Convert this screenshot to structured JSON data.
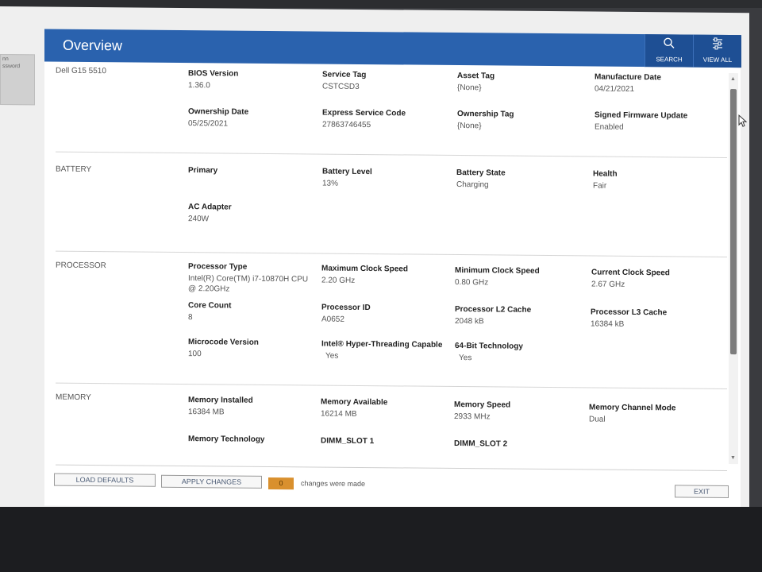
{
  "header": {
    "title": "Overview",
    "search_label": "SEARCH",
    "view_all_label": "VIEW ALL"
  },
  "left_panel": {
    "lines": [
      "nn",
      "ssword"
    ]
  },
  "system": {
    "model": "Dell G15 5510",
    "fields": [
      {
        "key": "BIOS Version",
        "value": "1.36.0"
      },
      {
        "key": "Service Tag",
        "value": "CSTCSD3"
      },
      {
        "key": "Asset Tag",
        "value": "{None}"
      },
      {
        "key": "Manufacture Date",
        "value": "04/21/2021"
      },
      {
        "key": "Ownership Date",
        "value": "05/25/2021"
      },
      {
        "key": "Express Service Code",
        "value": "27863746455"
      },
      {
        "key": "Ownership Tag",
        "value": "{None}"
      },
      {
        "key": "Signed Firmware Update",
        "value": "Enabled"
      }
    ]
  },
  "battery": {
    "title": "BATTERY",
    "fields": [
      {
        "key": "Primary",
        "value": ""
      },
      {
        "key": "Battery Level",
        "value": "13%"
      },
      {
        "key": "Battery State",
        "value": "Charging"
      },
      {
        "key": "Health",
        "value": "Fair"
      },
      {
        "key": "AC Adapter",
        "value": "240W"
      }
    ]
  },
  "processor": {
    "title": "PROCESSOR",
    "fields": [
      {
        "key": "Processor Type",
        "value": "Intel(R) Core(TM) i7-10870H CPU @ 2.20GHz"
      },
      {
        "key": "Maximum Clock Speed",
        "value": "2.20 GHz"
      },
      {
        "key": "Minimum Clock Speed",
        "value": "0.80 GHz"
      },
      {
        "key": "Current Clock Speed",
        "value": "2.67 GHz"
      },
      {
        "key": "Core Count",
        "value": "8"
      },
      {
        "key": "Processor ID",
        "value": "A0652"
      },
      {
        "key": "Processor L2 Cache",
        "value": "2048 kB"
      },
      {
        "key": "Processor L3 Cache",
        "value": "16384 kB"
      },
      {
        "key": "Microcode Version",
        "value": "100"
      },
      {
        "key": "Intel® Hyper-Threading Capable",
        "value": "Yes"
      },
      {
        "key": "64-Bit Technology",
        "value": "Yes"
      }
    ]
  },
  "memory": {
    "title": "MEMORY",
    "fields": [
      {
        "key": "Memory Installed",
        "value": "16384 MB"
      },
      {
        "key": "Memory Available",
        "value": "16214 MB"
      },
      {
        "key": "Memory Speed",
        "value": "2933 MHz"
      },
      {
        "key": "Memory Channel Mode",
        "value": "Dual"
      },
      {
        "key": "Memory Technology",
        "value": ""
      },
      {
        "key": "DIMM_SLOT 1",
        "value": ""
      },
      {
        "key": "DIMM_SLOT 2",
        "value": ""
      }
    ]
  },
  "footer": {
    "load_defaults": "LOAD DEFAULTS",
    "apply_changes": "APPLY CHANGES",
    "changes_count": "0",
    "changes_text": "changes were made",
    "exit": "EXIT"
  }
}
